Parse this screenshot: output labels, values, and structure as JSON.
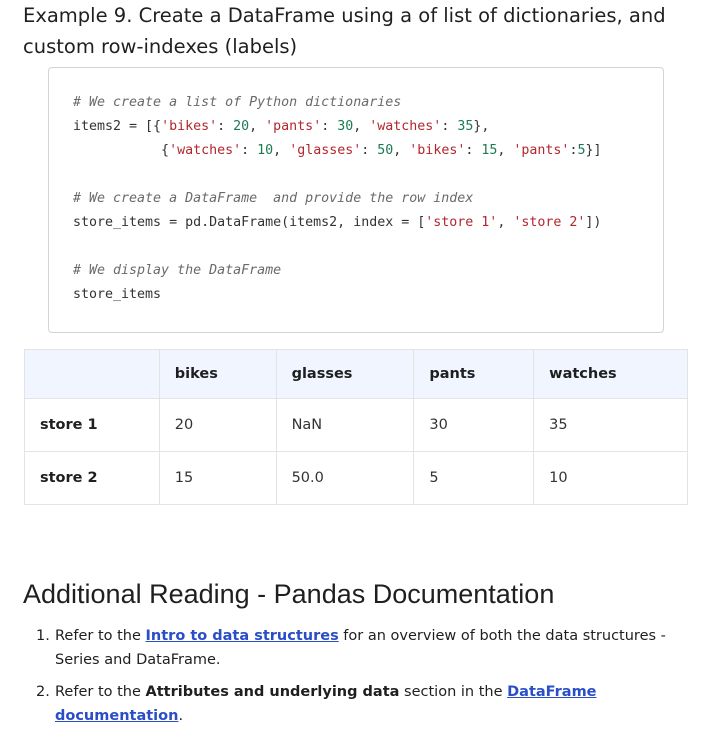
{
  "example": {
    "title": "Example 9. Create a DataFrame using a of list of dictionaries, and custom row-indexes (labels)"
  },
  "code": {
    "l1_comment": "# We create a list of Python dictionaries",
    "l2_a": "items2 = [{",
    "l2_b": "'bikes'",
    "l2_c": ": ",
    "l2_d": "20",
    "l2_e": ", ",
    "l2_f": "'pants'",
    "l2_g": ": ",
    "l2_h": "30",
    "l2_i": ", ",
    "l2_j": "'watches'",
    "l2_k": ": ",
    "l2_l": "35",
    "l2_m": "},",
    "l3_a": "           {",
    "l3_b": "'watches'",
    "l3_c": ": ",
    "l3_d": "10",
    "l3_e": ", ",
    "l3_f": "'glasses'",
    "l3_g": ": ",
    "l3_h": "50",
    "l3_i": ", ",
    "l3_j": "'bikes'",
    "l3_k": ": ",
    "l3_l": "15",
    "l3_m": ", ",
    "l3_n": "'pants'",
    "l3_o": ":",
    "l3_p": "5",
    "l3_q": "}]",
    "l4_comment": "# We create a DataFrame  and provide the row index",
    "l5_a": "store_items = pd.DataFrame(items2, index = [",
    "l5_b": "'store 1'",
    "l5_c": ", ",
    "l5_d": "'store 2'",
    "l5_e": "])",
    "l6_comment": "# We display the DataFrame",
    "l7": "store_items"
  },
  "table": {
    "columns": [
      "",
      "bikes",
      "glasses",
      "pants",
      "watches"
    ],
    "rows": [
      {
        "index": "store 1",
        "bikes": "20",
        "glasses": "NaN",
        "pants": "30",
        "watches": "35"
      },
      {
        "index": "store 2",
        "bikes": "15",
        "glasses": "50.0",
        "pants": "5",
        "watches": "10"
      }
    ]
  },
  "reading": {
    "heading": "Additional Reading - Pandas Documentation",
    "item1_num": "1.",
    "item1_pre": "Refer to the ",
    "item1_link": "Intro to data structures",
    "item1_post": " for an overview of both the data structures - Series and DataFrame.",
    "item2_num": "2.",
    "item2_pre": "Refer to the ",
    "item2_bold": "Attributes and underlying data",
    "item2_mid": " section in the ",
    "item2_link": "DataFrame documentation",
    "item2_post": "."
  }
}
